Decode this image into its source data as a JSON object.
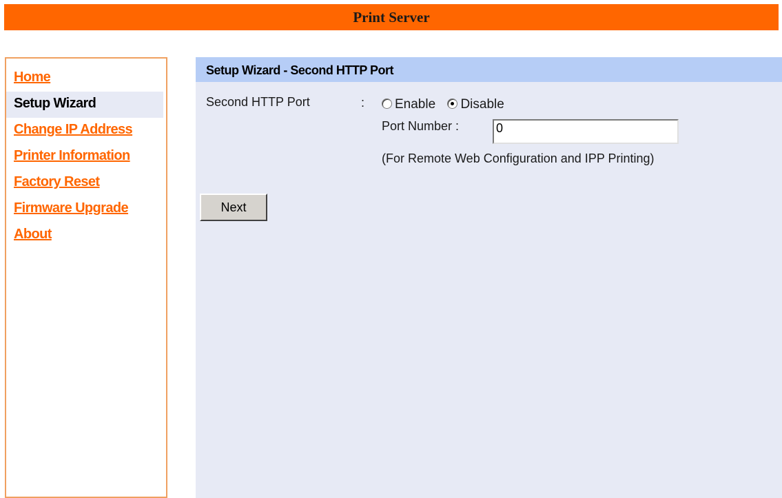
{
  "banner": {
    "title": "Print Server"
  },
  "sidebar": {
    "items": [
      {
        "label": "Home"
      },
      {
        "label": "Setup Wizard"
      },
      {
        "label": "Change IP Address"
      },
      {
        "label": "Printer Information"
      },
      {
        "label": "Factory Reset"
      },
      {
        "label": "Firmware Upgrade"
      },
      {
        "label": "About"
      }
    ],
    "active_index": 1
  },
  "main": {
    "header": "Setup Wizard - Second HTTP Port",
    "field_label": "Second HTTP Port",
    "colon": ":",
    "radio": {
      "options": [
        "Enable",
        "Disable"
      ],
      "selected": "Disable"
    },
    "port_label": "Port Number  :",
    "port_value": "0",
    "note": "(For Remote Web Configuration and IPP Printing)",
    "next_label": "Next"
  },
  "colors": {
    "banner": "#ff6600",
    "link": "#ff6600",
    "header": "#b6cdf6",
    "panel": "#e7eaf5"
  }
}
